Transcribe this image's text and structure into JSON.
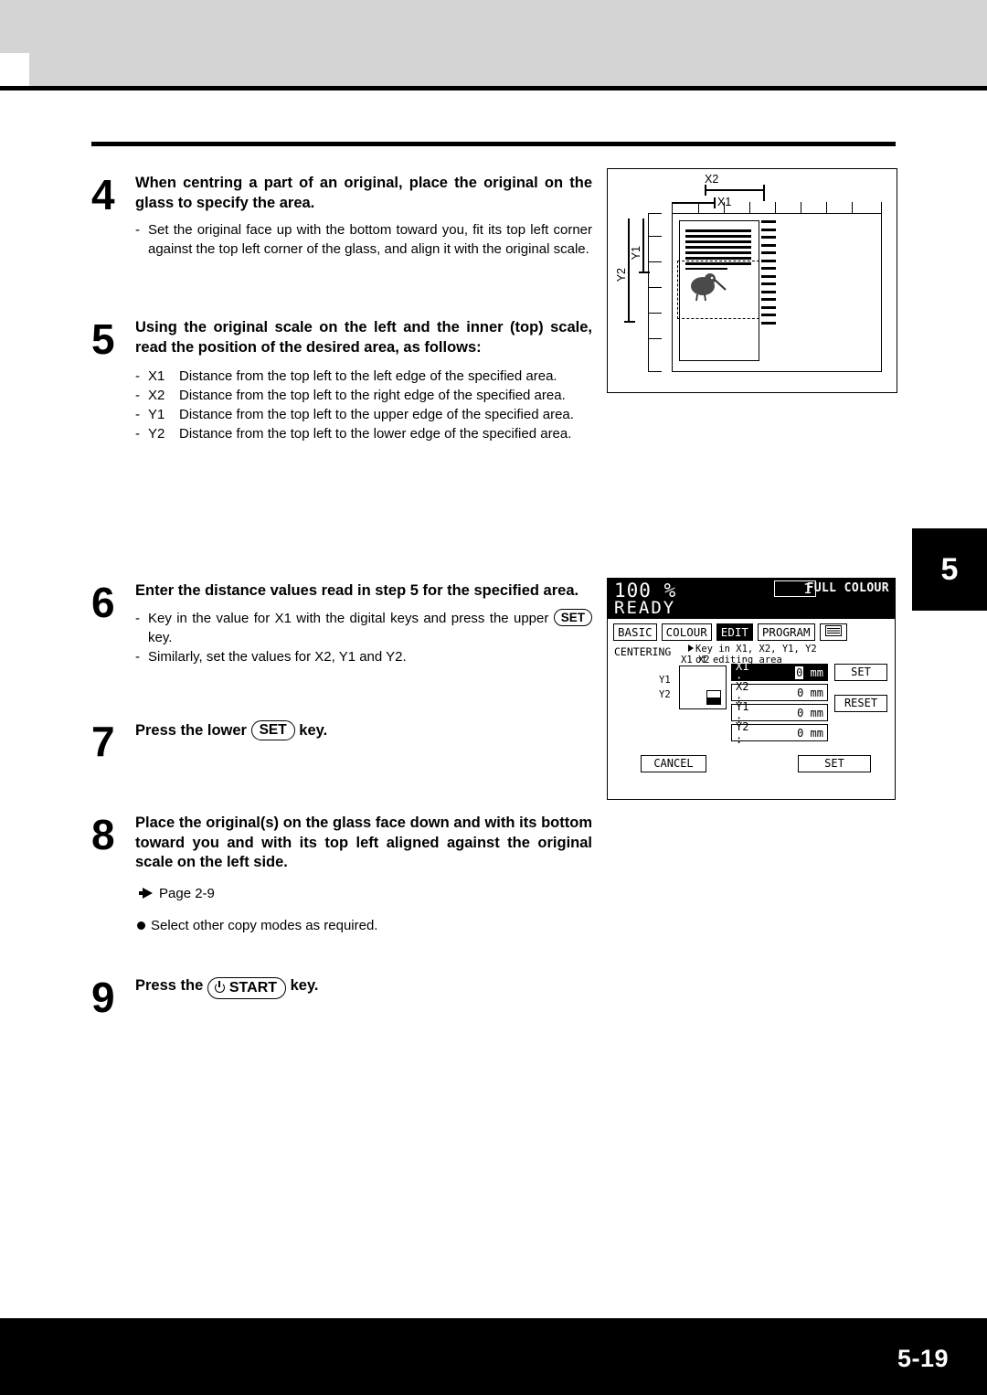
{
  "page": {
    "number": "5-19",
    "tab": "5"
  },
  "steps": [
    {
      "num": "4",
      "title": "When centring a part of an original, place the original on the glass to specify the area.",
      "bullets": [
        "Set the original face up with the bottom toward you, fit its top left corner against the top left corner of the glass, and align it with the original scale."
      ]
    },
    {
      "num": "5",
      "title": "Using the original scale on the left and the inner (top) scale, read the position of the desired area, as follows:",
      "definitions": [
        {
          "label": "X1",
          "text": "Distance from the top left to the left edge of the specified area."
        },
        {
          "label": "X2",
          "text": "Distance from the top left to the right edge of the specified area."
        },
        {
          "label": "Y1",
          "text": "Distance from the top left to the upper edge of the specified area."
        },
        {
          "label": "Y2",
          "text": "Distance from the top left to the lower edge of the specified area."
        }
      ]
    },
    {
      "num": "6",
      "title": "Enter the distance values read in step 5 for the specified area.",
      "bullets_rich": [
        {
          "pre": "Key in the value for X1 with the digital keys and press the upper ",
          "key": "SET",
          "post": " key."
        },
        {
          "pre": "Similarly, set the values for X2, Y1 and Y2.",
          "key": "",
          "post": ""
        }
      ]
    },
    {
      "num": "7",
      "title_pre": "Press the lower ",
      "key": "SET",
      "title_post": " key."
    },
    {
      "num": "8",
      "title": "Place the original(s) on the glass face down and with its bottom toward you and with its top left aligned against the original scale on the left side.",
      "reference": "Page 2-9",
      "note": "Select other copy modes as required."
    },
    {
      "num": "9",
      "title_pre": "Press the ",
      "key": "START",
      "title_post": " key."
    }
  ],
  "illustration": {
    "labels": {
      "x1": "X1",
      "x2": "X2",
      "y1": "Y1",
      "y2": "Y2"
    }
  },
  "lcd": {
    "zoom": "100 %",
    "status": "READY",
    "copy_count": "1",
    "colour_mode": "FULL COLOUR",
    "tabs": [
      {
        "label": "BASIC",
        "active": false
      },
      {
        "label": "COLOUR",
        "active": false
      },
      {
        "label": "EDIT",
        "active": true
      },
      {
        "label": "PROGRAM",
        "active": false
      }
    ],
    "mode_label": "CENTERING",
    "hint_line1": "Key in X1, X2, Y1, Y2",
    "hint_line2": "of editing area",
    "diagram_labels": {
      "top": "X1 X2",
      "y1": "Y1",
      "y2": "Y2"
    },
    "fields": [
      {
        "label": "X1 :",
        "value": "0",
        "unit": "mm",
        "highlighted": true
      },
      {
        "label": "X2 :",
        "value": "0",
        "unit": "mm",
        "highlighted": false
      },
      {
        "label": "Y1 :",
        "value": "0",
        "unit": "mm",
        "highlighted": false
      },
      {
        "label": "Y2 :",
        "value": "0",
        "unit": "mm",
        "highlighted": false
      }
    ],
    "side_buttons": [
      {
        "label": "SET"
      },
      {
        "label": "RESET"
      }
    ],
    "footer_buttons": [
      {
        "label": "CANCEL"
      },
      {
        "label": "SET"
      }
    ]
  }
}
